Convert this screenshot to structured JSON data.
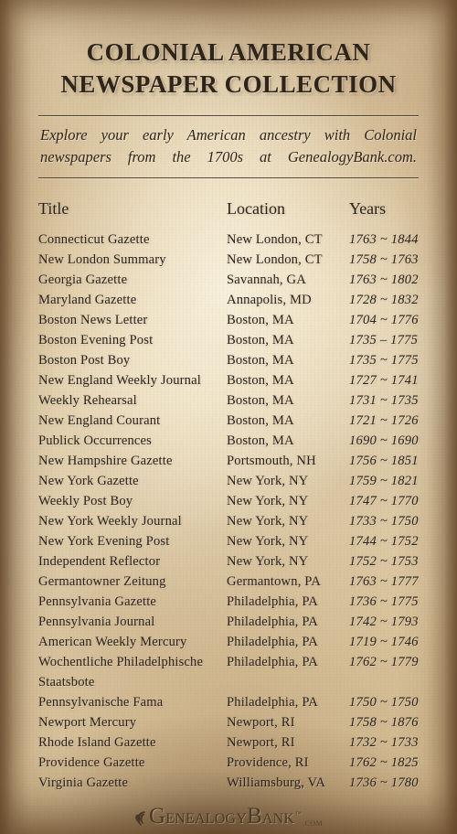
{
  "masthead": {
    "line1": "COLONIAL AMERICAN",
    "line2": "NEWSPAPER COLLECTION"
  },
  "tagline": {
    "line1": "Explore your early American ancestry with Colonial",
    "line2": "newspapers from the 1700s at GenealogyBank.com."
  },
  "table": {
    "headers": {
      "title": "Title",
      "location": "Location",
      "years": "Years"
    },
    "rows": [
      {
        "title": "Connecticut Gazette",
        "location": "New London, CT",
        "years": "1763 ~ 1844"
      },
      {
        "title": "New London Summary",
        "location": "New London, CT",
        "years": "1758 ~ 1763"
      },
      {
        "title": "Georgia Gazette",
        "location": "Savannah, GA",
        "years": "1763 ~ 1802"
      },
      {
        "title": "Maryland Gazette",
        "location": "Annapolis, MD",
        "years": "1728 ~ 1832"
      },
      {
        "title": "Boston News Letter",
        "location": "Boston, MA",
        "years": "1704 ~ 1776"
      },
      {
        "title": "Boston Evening Post",
        "location": "Boston, MA",
        "years": "1735 – 1775"
      },
      {
        "title": "Boston Post Boy",
        "location": "Boston, MA",
        "years": "1735 ~ 1775"
      },
      {
        "title": "New England Weekly Journal",
        "location": "Boston, MA",
        "years": "1727 ~ 1741"
      },
      {
        "title": "Weekly Rehearsal",
        "location": "Boston, MA",
        "years": "1731 ~ 1735"
      },
      {
        "title": "New England Courant",
        "location": "Boston, MA",
        "years": "1721 ~ 1726"
      },
      {
        "title": "Publick Occurrences",
        "location": "Boston, MA",
        "years": "1690 ~ 1690"
      },
      {
        "title": "New Hampshire Gazette",
        "location": "Portsmouth, NH",
        "years": "1756 ~ 1851"
      },
      {
        "title": "New York Gazette",
        "location": "New York, NY",
        "years": "1759 ~ 1821"
      },
      {
        "title": "Weekly Post Boy",
        "location": "New York, NY",
        "years": "1747 ~ 1770"
      },
      {
        "title": "New York Weekly Journal",
        "location": "New York, NY",
        "years": "1733 ~ 1750"
      },
      {
        "title": "New York Evening Post",
        "location": "New York, NY",
        "years": "1744 ~ 1752"
      },
      {
        "title": "Independent Reflector",
        "location": "New York, NY",
        "years": "1752 ~ 1753"
      },
      {
        "title": "Germantowner Zeitung",
        "location": "Germantown, PA",
        "years": "1763 ~ 1777"
      },
      {
        "title": "Pennsylvania Gazette",
        "location": "Philadelphia, PA",
        "years": "1736 ~ 1775"
      },
      {
        "title": "Pennsylvania Journal",
        "location": "Philadelphia, PA",
        "years": "1742 ~ 1793"
      },
      {
        "title": "American Weekly Mercury",
        "location": "Philadelphia, PA",
        "years": "1719 ~ 1746"
      },
      {
        "title": "Wochentliche Philadelphische",
        "location": "Philadelphia, PA",
        "years": "1762 ~ 1779"
      },
      {
        "title": "Staatsbote",
        "location": "",
        "years": ""
      },
      {
        "title": "Pennsylvanische Fama",
        "location": "Philadelphia, PA",
        "years": "1750 ~ 1750"
      },
      {
        "title": "Newport Mercury",
        "location": "Newport, RI",
        "years": "1758 ~ 1876"
      },
      {
        "title": "Rhode Island Gazette",
        "location": "Newport, RI",
        "years": "1732 ~ 1733"
      },
      {
        "title": "Providence Gazette",
        "location": "Providence, RI",
        "years": "1762 ~ 1825"
      },
      {
        "title": "Virginia Gazette",
        "location": "Williamsburg, VA",
        "years": "1736 ~ 1780"
      }
    ]
  },
  "footer": {
    "logo_g": "G",
    "logo_enealogy": "ENEALOGY",
    "logo_b": "B",
    "logo_ank": "ANK",
    "logo_tm": "™",
    "logo_dotcom": ".COM"
  },
  "colors": {
    "ink": "#2b2118",
    "paper": "#e3d2b0",
    "logo_ink": "#463522"
  }
}
